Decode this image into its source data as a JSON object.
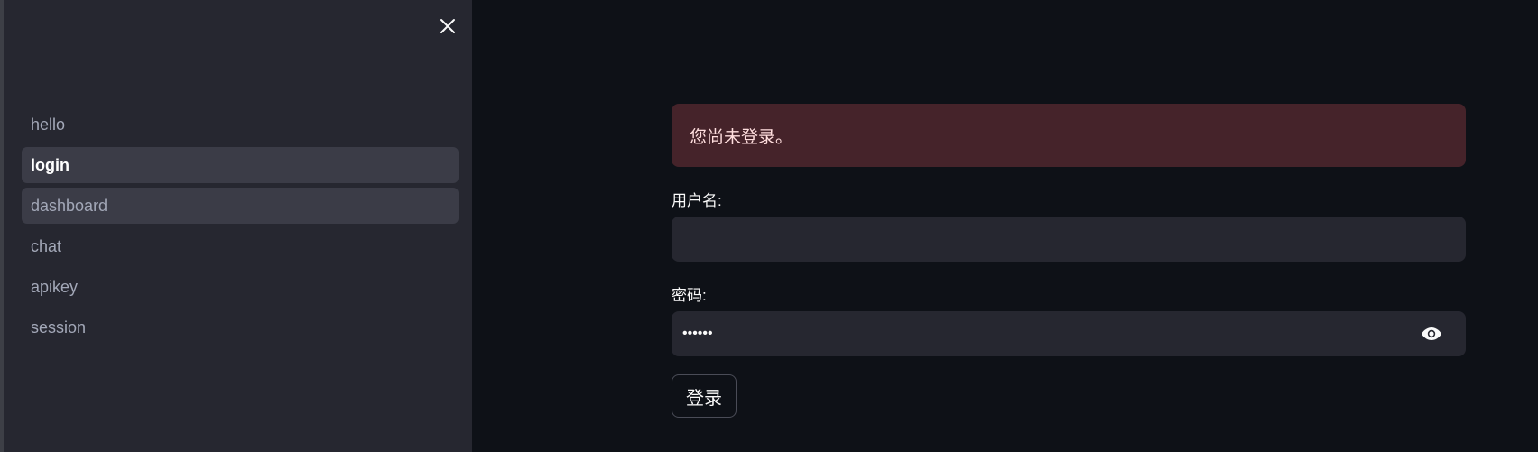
{
  "sidebar": {
    "close_icon": "close-icon",
    "items": [
      {
        "label": "hello",
        "state": "default"
      },
      {
        "label": "login",
        "state": "active"
      },
      {
        "label": "dashboard",
        "state": "hover"
      },
      {
        "label": "chat",
        "state": "default"
      },
      {
        "label": "apikey",
        "state": "default"
      },
      {
        "label": "session",
        "state": "default"
      }
    ]
  },
  "main": {
    "alert": {
      "text": "您尚未登录。",
      "color": "#45232a"
    },
    "username": {
      "label": "用户名:",
      "value": ""
    },
    "password": {
      "label": "密码:",
      "value": "••••••",
      "toggle_icon": "eye-icon"
    },
    "login_button": {
      "label": "登录"
    }
  },
  "colors": {
    "background": "#0e1117",
    "sidebar": "#262730",
    "input": "#262730",
    "nav_active": "#3b3c47"
  }
}
